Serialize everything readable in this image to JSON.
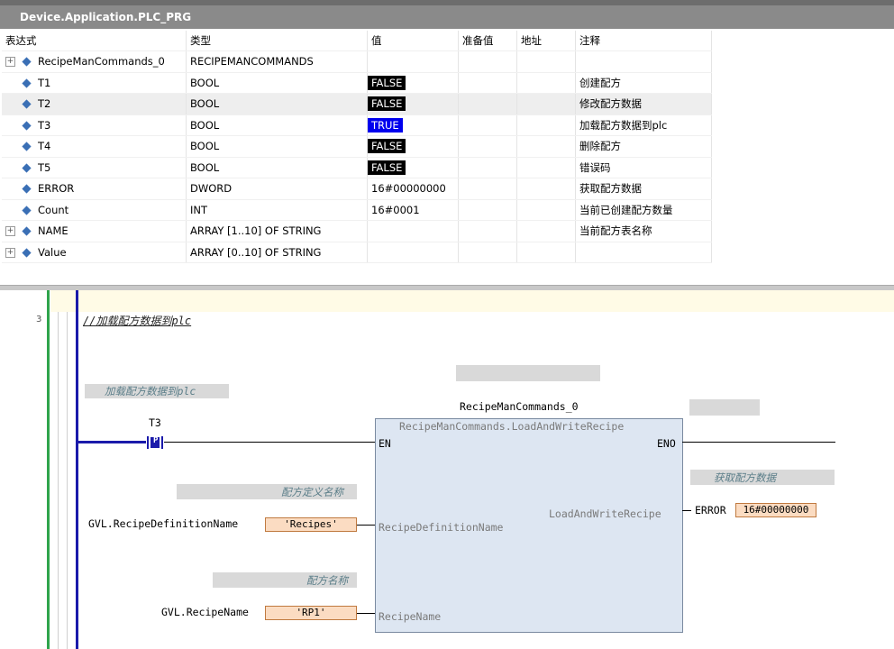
{
  "window": {
    "title": "Device.Application.PLC_PRG"
  },
  "watch": {
    "headers": [
      "表达式",
      "类型",
      "值",
      "准备值",
      "地址",
      "注释"
    ],
    "rows": [
      {
        "expr": "RecipeManCommands_0",
        "type": "RECIPEMANCOMMANDS",
        "value": "",
        "comment": "",
        "expandable": true,
        "bool": ""
      },
      {
        "expr": "T1",
        "type": "BOOL",
        "value": "FALSE",
        "comment": "创建配方",
        "expandable": false,
        "bool": "false"
      },
      {
        "expr": "T2",
        "type": "BOOL",
        "value": "FALSE",
        "comment": "修改配方数据",
        "expandable": false,
        "bool": "false"
      },
      {
        "expr": "T3",
        "type": "BOOL",
        "value": "TRUE",
        "comment": "加载配方数据到plc",
        "expandable": false,
        "bool": "true"
      },
      {
        "expr": "T4",
        "type": "BOOL",
        "value": "FALSE",
        "comment": "删除配方",
        "expandable": false,
        "bool": "false"
      },
      {
        "expr": "T5",
        "type": "BOOL",
        "value": "FALSE",
        "comment": "错误码",
        "expandable": false,
        "bool": "false"
      },
      {
        "expr": "ERROR",
        "type": "DWORD",
        "value": "16#00000000",
        "comment": "获取配方数据",
        "expandable": false,
        "bool": ""
      },
      {
        "expr": "Count",
        "type": "INT",
        "value": "16#0001",
        "comment": "当前已创建配方数量",
        "expandable": false,
        "bool": ""
      },
      {
        "expr": "NAME",
        "type": "ARRAY [1..10] OF STRING",
        "value": "",
        "comment": "当前配方表名称",
        "expandable": true,
        "bool": ""
      },
      {
        "expr": "Value",
        "type": "ARRAY [0..10] OF STRING",
        "value": "",
        "comment": "",
        "expandable": true,
        "bool": ""
      }
    ]
  },
  "ladder": {
    "network_number": "3",
    "network_comment": "//加载配方数据到plc",
    "rung_label": "加载配方数据到plc",
    "contact_name": "T3",
    "contact_symbol": "P",
    "fb_instance": "RecipeManCommands_0",
    "fb_type": "RecipeManCommands.LoadAndWriteRecipe",
    "pin_en": "EN",
    "pin_eno": "ENO",
    "pin_in1": "RecipeDefinitionName",
    "pin_in2": "RecipeName",
    "pin_out": "LoadAndWriteRecipe",
    "in1_comment": "配方定义名称",
    "in1_var": "GVL.RecipeDefinitionName",
    "in1_value": "'Recipes'",
    "in2_comment": "配方名称",
    "in2_var": "GVL.RecipeName",
    "in2_value": "'RP1'",
    "out_comment": "获取配方数据",
    "out_var": "ERROR",
    "out_value": "16#00000000"
  },
  "colors": {
    "true_bg": "#0000ee",
    "false_bg": "#000000",
    "fb_fill": "#dde6f2",
    "value_box": "#fbdcc2",
    "power_rail": "#1a1aaa",
    "network_rail": "#2fa44c"
  }
}
